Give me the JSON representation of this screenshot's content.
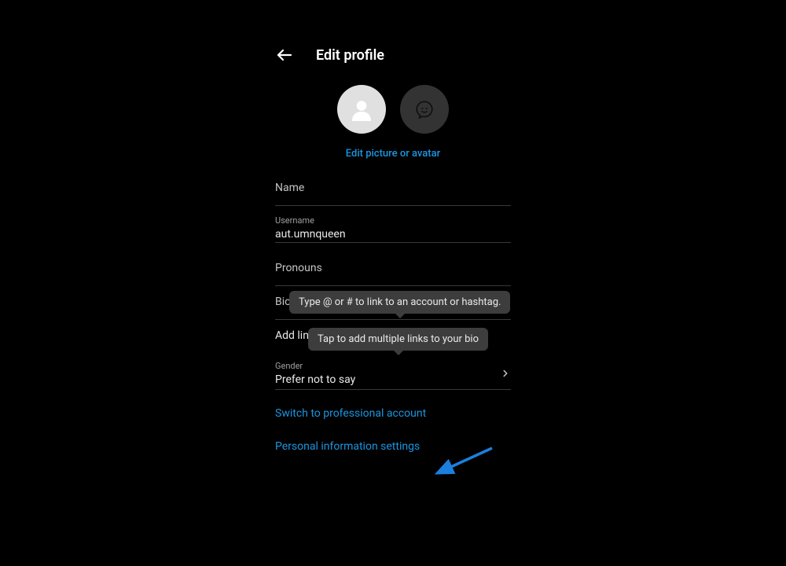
{
  "header": {
    "title": "Edit profile"
  },
  "avatar": {
    "edit_link": "Edit picture or avatar"
  },
  "fields": {
    "name": {
      "label": "Name"
    },
    "username": {
      "label": "Username",
      "value": "aut.umnqueen"
    },
    "pronouns": {
      "label": "Pronouns"
    },
    "bio": {
      "label": "Bio"
    },
    "addlink": {
      "label": "Add link"
    },
    "gender": {
      "label": "Gender",
      "value": "Prefer not to say"
    }
  },
  "tooltips": {
    "bio_hint": "Type @ or # to link to an account or hashtag.",
    "link_hint": "Tap to add multiple links to your bio"
  },
  "links": {
    "switch_pro": "Switch to professional account",
    "personal_info": "Personal information settings"
  },
  "colors": {
    "accent": "#1b95e0",
    "arrow": "#1b7fe0"
  }
}
